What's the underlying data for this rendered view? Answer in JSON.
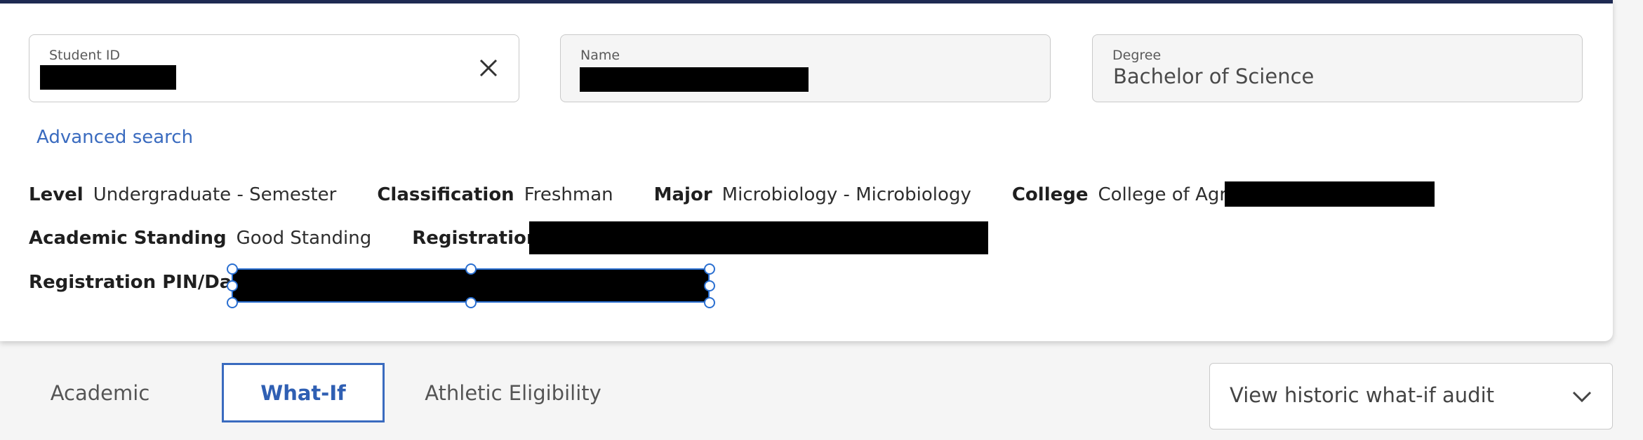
{
  "header_fields": {
    "student_id": {
      "label": "Student ID",
      "value": ""
    },
    "name": {
      "label": "Name",
      "value": ""
    },
    "degree": {
      "label": "Degree",
      "value": "Bachelor of Science"
    }
  },
  "advanced_search_label": "Advanced search",
  "student_info": {
    "level": {
      "label": "Level",
      "value": "Undergraduate - Semester"
    },
    "classification": {
      "label": "Classification",
      "value": "Freshman"
    },
    "major": {
      "label": "Major",
      "value": "Microbiology - Microbiology"
    },
    "college": {
      "label": "College",
      "value": "College of Agriculture"
    },
    "academic_standing": {
      "label": "Academic Standing",
      "value": "Good Standing"
    },
    "registration_hold": {
      "label": "Registration Hold",
      "value": ""
    },
    "registration_pin": {
      "label": "Registration PIN/Date",
      "value": ""
    }
  },
  "tabs": [
    {
      "label": "Academic",
      "active": false
    },
    {
      "label": "What-If",
      "active": true
    },
    {
      "label": "Athletic Eligibility",
      "active": false
    }
  ],
  "historic_dropdown": {
    "selected": "View historic what-if audit",
    "icon": "chevron-down-icon"
  },
  "icons": {
    "clear": "close-icon"
  },
  "colors": {
    "accent": "#3a6bbf",
    "header_bar": "#1e2a52",
    "selection": "#2a6fd1",
    "redaction": "#000000"
  }
}
